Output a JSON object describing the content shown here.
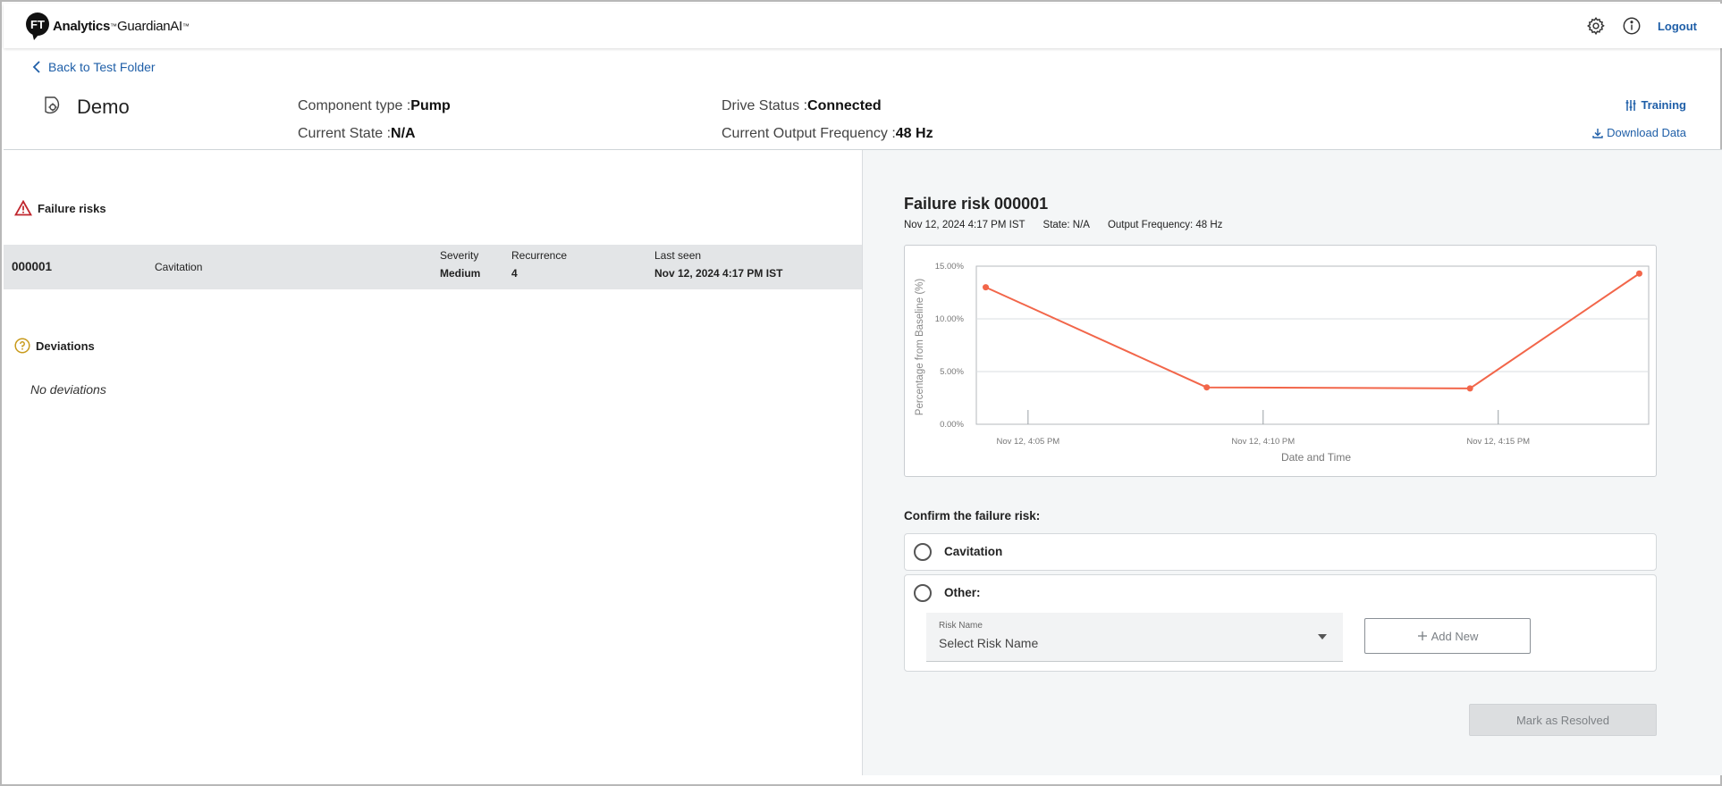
{
  "app": {
    "brand_bold": "Analytics",
    "brand_regular": "GuardianAI",
    "logo_letters": "FT",
    "logout_label": "Logout"
  },
  "header": {
    "back_label": "Back to Test Folder",
    "title": "Demo",
    "component_type_label": "Component type :",
    "component_type_value": "Pump",
    "current_state_label": "Current State :",
    "current_state_value": "N/A",
    "drive_status_label": "Drive Status :",
    "drive_status_value": "Connected",
    "output_freq_label": "Current Output Frequency :",
    "output_freq_value": "48 Hz",
    "training_label": "Training",
    "download_label": "Download Data"
  },
  "failure_risks": {
    "title": "Failure risks",
    "rows": [
      {
        "id": "000001",
        "name": "Cavitation",
        "severity_label": "Severity",
        "severity": "Medium",
        "recurrence_label": "Recurrence",
        "recurrence": "4",
        "last_seen_label": "Last seen",
        "last_seen": "Nov 12, 2024 4:17 PM IST"
      }
    ]
  },
  "deviations": {
    "title": "Deviations",
    "empty_text": "No deviations"
  },
  "detail": {
    "title": "Failure risk 000001",
    "timestamp": "Nov 12, 2024 4:17 PM IST",
    "state": "State: N/A",
    "output_frequency": "Output Frequency: 48 Hz",
    "confirm_label": "Confirm the failure risk:",
    "option_cavitation": "Cavitation",
    "option_other": "Other:",
    "risk_name_label": "Risk Name",
    "risk_name_placeholder": "Select Risk Name",
    "add_new_label": "Add New",
    "resolve_label": "Mark as Resolved"
  },
  "colors": {
    "accent": "#1f5fa8",
    "line": "#f2664a",
    "warning": "#c0262d",
    "question": "#c89a1b"
  },
  "chart_data": {
    "type": "line",
    "title": "",
    "xlabel": "Date and Time",
    "ylabel": "Percentage from Baseline (%)",
    "ylim": [
      0,
      15
    ],
    "y_ticks": [
      "0.00%",
      "5.00%",
      "10.00%",
      "15.00%"
    ],
    "x_ticks": [
      "Nov 12, 4:05 PM",
      "Nov 12, 4:10 PM",
      "Nov 12, 4:15 PM"
    ],
    "x_tick_minutes": [
      5,
      10,
      15
    ],
    "x_range_minutes": [
      3.9,
      18.2
    ],
    "grid": true,
    "series": [
      {
        "x_minutes": [
          4.1,
          8.8,
          14.4,
          18.0
        ],
        "values": [
          13.0,
          3.5,
          3.4,
          14.3
        ]
      }
    ]
  }
}
